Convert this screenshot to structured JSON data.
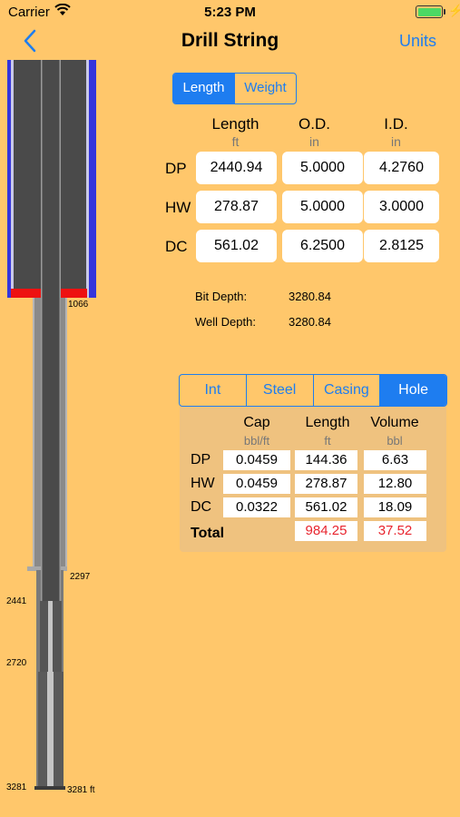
{
  "status_bar": {
    "carrier": "Carrier",
    "time": "5:23 PM"
  },
  "nav": {
    "title": "Drill String",
    "units_label": "Units"
  },
  "mode_tabs": [
    {
      "label": "Length",
      "selected": true
    },
    {
      "label": "Weight",
      "selected": false
    }
  ],
  "dimensions": {
    "columns": [
      {
        "label": "Length",
        "unit": "ft"
      },
      {
        "label": "O.D.",
        "unit": "in"
      },
      {
        "label": "I.D.",
        "unit": "in"
      }
    ],
    "rows": [
      {
        "label": "DP",
        "length": "2440.94",
        "od": "5.0000",
        "id": "4.2760"
      },
      {
        "label": "HW",
        "length": "278.87",
        "od": "5.0000",
        "id": "3.0000"
      },
      {
        "label": "DC",
        "length": "561.02",
        "od": "6.2500",
        "id": "2.8125"
      }
    ]
  },
  "depths": {
    "bit_depth_label": "Bit Depth:",
    "bit_depth": "3280.84",
    "well_depth_label": "Well Depth:",
    "well_depth": "3280.84"
  },
  "volume_tabs": [
    {
      "label": "Int",
      "selected": false
    },
    {
      "label": "Steel",
      "selected": false
    },
    {
      "label": "Casing",
      "selected": false
    },
    {
      "label": "Hole",
      "selected": true
    }
  ],
  "volume": {
    "columns": [
      {
        "label": "Cap",
        "unit": "bbl/ft"
      },
      {
        "label": "Length",
        "unit": "ft"
      },
      {
        "label": "Volume",
        "unit": "bbl"
      }
    ],
    "rows": [
      {
        "label": "DP",
        "cap": "0.0459",
        "length": "144.36",
        "volume": "6.63"
      },
      {
        "label": "HW",
        "cap": "0.0459",
        "length": "278.87",
        "volume": "12.80"
      },
      {
        "label": "DC",
        "cap": "0.0322",
        "length": "561.02",
        "volume": "18.09"
      }
    ],
    "total_label": "Total",
    "total_length": "984.25",
    "total_volume": "37.52"
  },
  "diagram": {
    "labels": {
      "casing_shoe_1": "1066",
      "casing_shoe_2": "2297",
      "dp_bottom": "2441",
      "hw_bottom": "2720",
      "bit_left": "3281",
      "bit_right": "3281 ft"
    }
  },
  "colors": {
    "accent": "#1E7DF0",
    "background": "#FFC76B",
    "total_text": "#E8242E"
  }
}
